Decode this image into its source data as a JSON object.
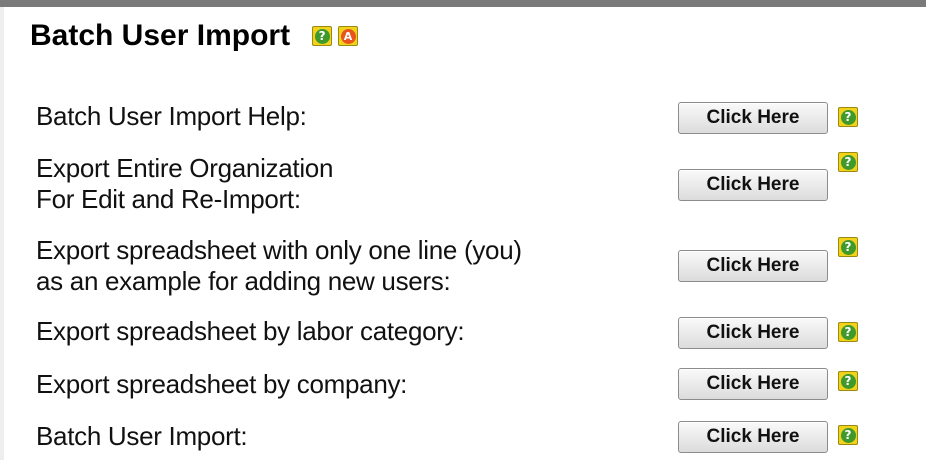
{
  "panel": {
    "title": "Batch User Import",
    "help_icon": "help-icon",
    "admin_icon": "admin-icon",
    "help_glyph": "?",
    "admin_glyph": "A"
  },
  "rows": [
    {
      "label_line1": "Batch User Import Help:",
      "label_line2": "",
      "button_label": "Click Here",
      "icon": "help-icon",
      "icon_glyph": "?"
    },
    {
      "label_line1": "Export Entire Organization",
      "label_line2": "For Edit and Re-Import:",
      "button_label": "Click Here",
      "icon": "help-icon",
      "icon_glyph": "?"
    },
    {
      "label_line1": "Export spreadsheet with only one line (you)",
      "label_line2": "as an example for adding new users:",
      "button_label": "Click Here",
      "icon": "help-icon",
      "icon_glyph": "?"
    },
    {
      "label_line1": "Export spreadsheet by labor category:",
      "label_line2": "",
      "button_label": "Click Here",
      "icon": "help-icon",
      "icon_glyph": "?"
    },
    {
      "label_line1": "Export spreadsheet by company:",
      "label_line2": "",
      "button_label": "Click Here",
      "icon": "help-icon",
      "icon_glyph": "?"
    },
    {
      "label_line1": "Batch User Import:",
      "label_line2": "",
      "button_label": "Click Here",
      "icon": "help-icon",
      "icon_glyph": "?"
    }
  ]
}
